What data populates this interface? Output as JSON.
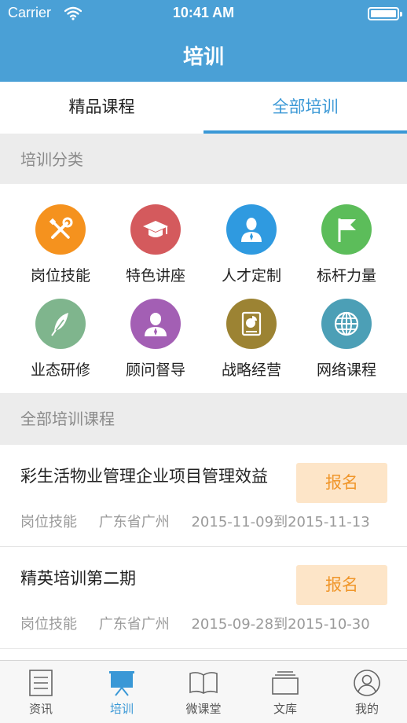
{
  "status_bar": {
    "carrier": "Carrier",
    "time": "10:41 AM"
  },
  "nav": {
    "title": "培训"
  },
  "tabs": [
    {
      "label": "精品课程",
      "active": false
    },
    {
      "label": "全部培训",
      "active": true
    }
  ],
  "category_section": {
    "header": "培训分类"
  },
  "categories": [
    {
      "label": "岗位技能",
      "icon": "tools-icon",
      "color": "#f5921e"
    },
    {
      "label": "特色讲座",
      "icon": "graduation-cap-icon",
      "color": "#d45a5d"
    },
    {
      "label": "人才定制",
      "icon": "person-icon",
      "color": "#2f9ae0"
    },
    {
      "label": "标杆力量",
      "icon": "flag-icon",
      "color": "#5cbd5a"
    },
    {
      "label": "业态研修",
      "icon": "feather-icon",
      "color": "#7fb58d"
    },
    {
      "label": "顾问督导",
      "icon": "advisor-icon",
      "color": "#a35fb4"
    },
    {
      "label": "战略经营",
      "icon": "report-chart-icon",
      "color": "#9c8333"
    },
    {
      "label": "网络课程",
      "icon": "globe-icon",
      "color": "#4c9fb6"
    }
  ],
  "courses_section": {
    "header": "全部培训课程"
  },
  "courses": [
    {
      "name": "彩生活物业管理企业项目管理效益",
      "category": "岗位技能",
      "location": "广东省广州",
      "dates": "2015-11-09到2015-11-13",
      "button": "报名"
    },
    {
      "name": "精英培训第二期",
      "category": "岗位技能",
      "location": "广东省广州",
      "dates": "2015-09-28到2015-10-30",
      "button": "报名"
    }
  ],
  "tab_bar": [
    {
      "label": "资讯",
      "icon": "news-icon",
      "active": false
    },
    {
      "label": "培训",
      "icon": "training-board-icon",
      "active": true
    },
    {
      "label": "微课堂",
      "icon": "book-icon",
      "active": false
    },
    {
      "label": "文库",
      "icon": "library-icon",
      "active": false
    },
    {
      "label": "我的",
      "icon": "profile-icon",
      "active": false
    }
  ],
  "colors": {
    "primary": "#4aa0d6",
    "accent": "#3a98d6",
    "button_bg": "#fde5c8",
    "button_text": "#f0962a"
  }
}
